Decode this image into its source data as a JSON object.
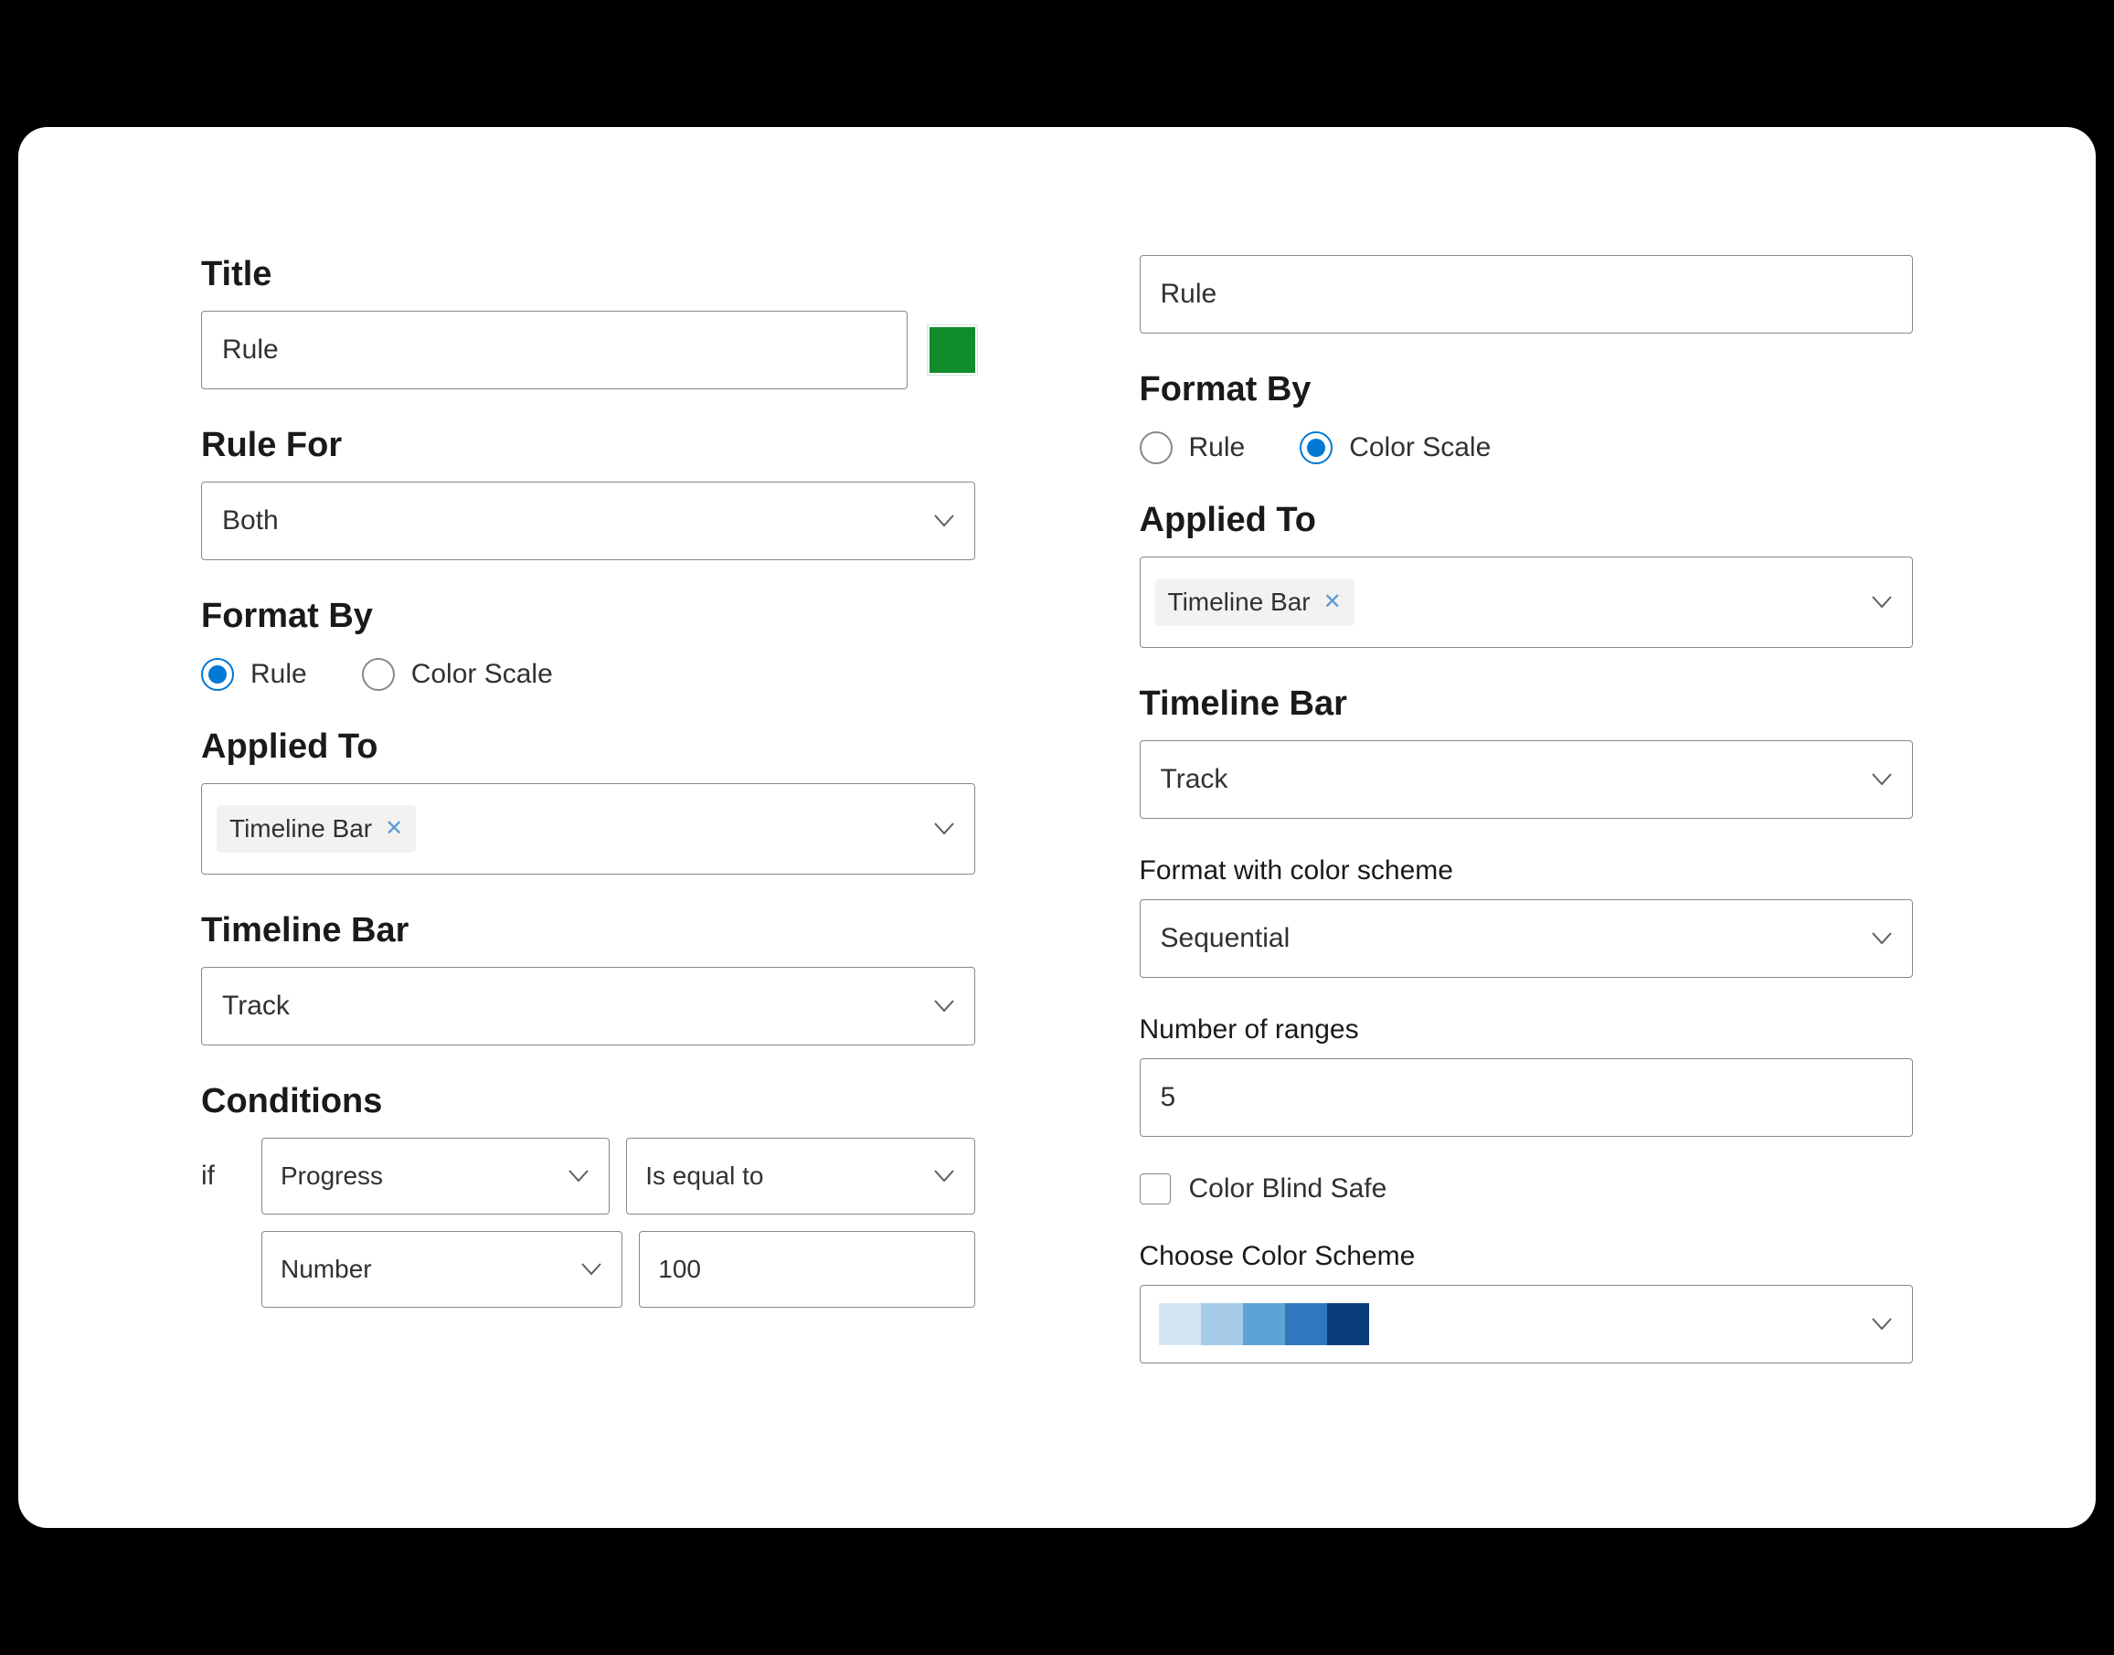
{
  "left": {
    "title_label": "Title",
    "title_value": "Rule",
    "swatch_color": "#0f8c2c",
    "rule_for_label": "Rule For",
    "rule_for_value": "Both",
    "format_by_label": "Format By",
    "format_by_options": {
      "rule": "Rule",
      "color_scale": "Color Scale"
    },
    "format_by_selected": "rule",
    "applied_to_label": "Applied To",
    "applied_to_tags": [
      "Timeline Bar"
    ],
    "timeline_bar_label": "Timeline Bar",
    "timeline_bar_value": "Track",
    "conditions_label": "Conditions",
    "if_label": "if",
    "condition_field": "Progress",
    "condition_operator": "Is equal to",
    "condition_type": "Number",
    "condition_value": "100"
  },
  "right": {
    "title_value": "Rule",
    "format_by_label": "Format By",
    "format_by_options": {
      "rule": "Rule",
      "color_scale": "Color Scale"
    },
    "format_by_selected": "color_scale",
    "applied_to_label": "Applied To",
    "applied_to_tags": [
      "Timeline Bar"
    ],
    "timeline_bar_label": "Timeline Bar",
    "timeline_bar_value": "Track",
    "format_scheme_label": "Format with color scheme",
    "format_scheme_value": "Sequential",
    "num_ranges_label": "Number of ranges",
    "num_ranges_value": "5",
    "color_blind_label": "Color Blind Safe",
    "color_blind_checked": false,
    "choose_scheme_label": "Choose Color Scheme",
    "scheme_colors": [
      "#d6e5f3",
      "#a5cbe8",
      "#5ea3d6",
      "#2f78bd",
      "#0b3d7a"
    ]
  }
}
